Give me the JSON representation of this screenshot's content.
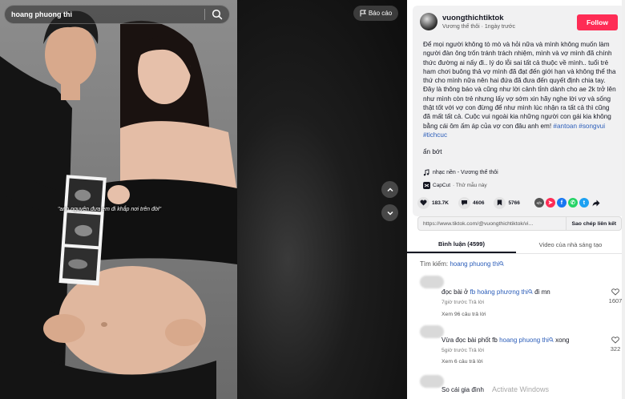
{
  "search": {
    "query": "hoang phuong thi"
  },
  "video": {
    "report_label": "Báo cáo",
    "overlay_caption": "\"anh nguyện đưa em đi khắp nơi trên đời\""
  },
  "author": {
    "username": "vuongthichtiktok",
    "display_name": "Vương thế thôi",
    "posted": "1ngày trước",
    "follow_label": "Follow"
  },
  "description": {
    "text": "Để mọi người không tò mò và hỏi nữa và mình không muốn làm người đàn ông trốn tránh trách nhiệm, mình và vợ mình đã chính thức đường ai nấy đi.. lý do lỗi sai tất cả thuộc về mình.. tuổi trẻ ham chơi buông thả vợ mình đã đạt đến giới hạn và không thể tha thứ cho mình nữa nên hai đứa đã đưa đến quyết định chia tay. Đây là thông báo và cũng như lời cảnh tỉnh dành cho ae 2k trở lên như mình còn trẻ nhưng lấy vợ sớm xin hãy nghe lời vợ và sống thật tốt với vợ con đừng để như mình lúc nhận ra tất cả thì cũng đã mất tất cả. Cuộc vui ngoài kia những người con gái kia không bằng cái ôm ấm áp của vợ con đâu anh em! ",
    "hashtags": "#antoan #songvui #tichcuc",
    "collapse_label": "ẩn bớt",
    "music": "nhạc nền - Vương thế thôi",
    "capcut_name": "CapCut",
    "capcut_sub": "· Thử mẫu này"
  },
  "stats": {
    "likes": "183.7K",
    "comments": "4606",
    "saves": "5766"
  },
  "share_icons": [
    {
      "name": "embed-icon",
      "glyph": "</>",
      "color": "#555555"
    },
    {
      "name": "paper-plane-icon",
      "glyph": "➤",
      "color": "#fe2c55"
    },
    {
      "name": "facebook-icon",
      "glyph": "f",
      "color": "#1877f2"
    },
    {
      "name": "whatsapp-icon",
      "glyph": "✆",
      "color": "#25d366"
    },
    {
      "name": "twitter-icon",
      "glyph": "t",
      "color": "#1da1f2"
    }
  ],
  "link": {
    "url": "https://www.tiktok.com/@vuongthichtiktok/vi...",
    "copy_label": "Sao chép liên kết"
  },
  "tabs": [
    {
      "label": "Bình luận (4599)",
      "active": true
    },
    {
      "label": "Video của nhà sáng tạo",
      "active": false
    }
  ],
  "search_recommendation": {
    "prefix": "Tìm kiếm:",
    "keyword": "hoang phuong thi"
  },
  "comments": [
    {
      "text_before": "đọc bài ở ",
      "keyword": "fb hoàng phương thi",
      "text_after": " đi mn",
      "meta": "7giờ trước  Trả lời",
      "replies": "Xem 96 câu trả lời",
      "likes": "1607"
    },
    {
      "text_before": "Vừa đọc bài phốt fb ",
      "keyword": "hoang phuong thi",
      "text_after": " xong",
      "meta": "5giờ trước  Trả lời",
      "replies": "Xem 6 câu trả lời",
      "likes": "322"
    },
    {
      "text_before": "So cái gia đình ",
      "keyword": "",
      "text_after": "",
      "meta": "",
      "replies": "",
      "likes": ""
    }
  ],
  "watermark": "Activate Windows",
  "colors": {
    "accent": "#fe2c55",
    "link": "#2b5db9"
  }
}
